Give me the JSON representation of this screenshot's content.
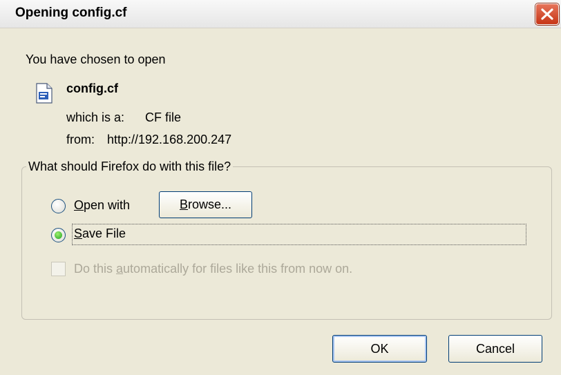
{
  "window": {
    "title": "Opening config.cf"
  },
  "intro": "You have chosen to open",
  "file": {
    "icon": "document-icon",
    "name": "config.cf",
    "type_label": "which is a:",
    "type_value": "CF file",
    "from_label": "from:",
    "from_value": "http://192.168.200.247"
  },
  "action_group": {
    "legend": "What should Firefox do with this file?",
    "open_with": {
      "access_key": "O",
      "rest": "pen with",
      "selected": false
    },
    "browse": {
      "access_key": "B",
      "rest": "rowse..."
    },
    "save_file": {
      "access_key": "S",
      "rest": "ave File",
      "selected": true
    },
    "auto": {
      "before": "Do this ",
      "access_key": "a",
      "after": "utomatically for files like this from now on.",
      "checked": false,
      "enabled": false
    }
  },
  "buttons": {
    "ok": "OK",
    "cancel": "Cancel"
  }
}
